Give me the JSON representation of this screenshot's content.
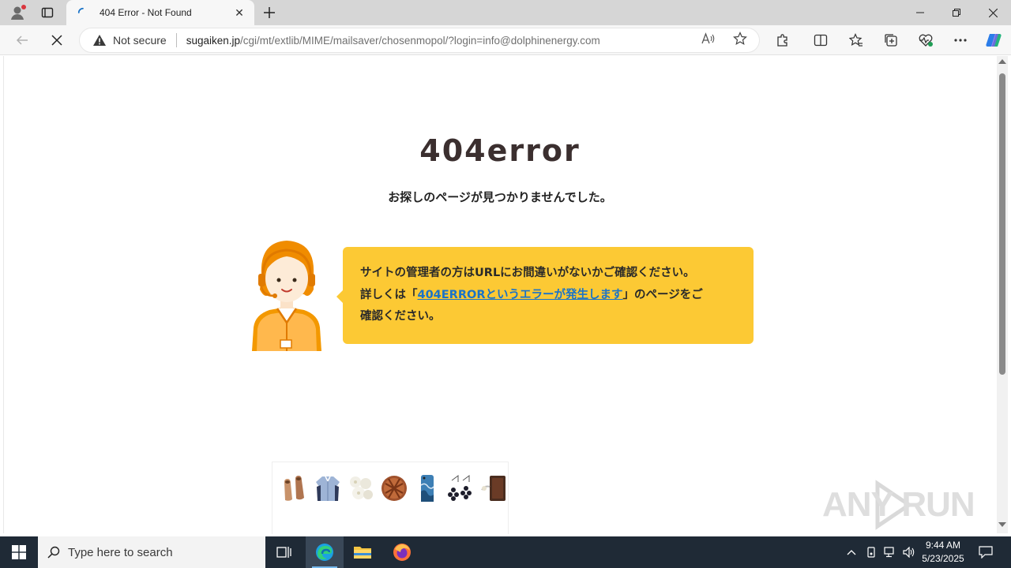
{
  "browser": {
    "tab": {
      "title": "404 Error - Not Found"
    },
    "address": {
      "security_label": "Not secure",
      "url_host": "sugaiken.jp",
      "url_path": "/cgi/mt/extlib/MIME/mailsaver/chosenmopol/?login=info@dolphinenergy.com"
    }
  },
  "page": {
    "title": "404error",
    "subtitle": "お探しのページが見つかりませんでした。",
    "message": {
      "line1": "サイトの管理者の方はURLにお間違いがないかご確認ください。",
      "line2_prefix": "詳しくは「",
      "link_text": "404ERRORというエラーが発生します",
      "line2_suffix": "」のページをご",
      "line3": "確認ください。"
    },
    "ad_items": [
      "shoes",
      "shirt",
      "flowers",
      "pie",
      "phone-case",
      "earrings",
      "wallet"
    ],
    "colors": {
      "bubble": "#fcc934",
      "link": "#1a73c8",
      "mascot": "#f08c00"
    }
  },
  "watermark": {
    "text": "ANY RUN"
  },
  "taskbar": {
    "search_placeholder": "Type here to search",
    "time": "9:44 AM",
    "date": "5/23/2025"
  }
}
